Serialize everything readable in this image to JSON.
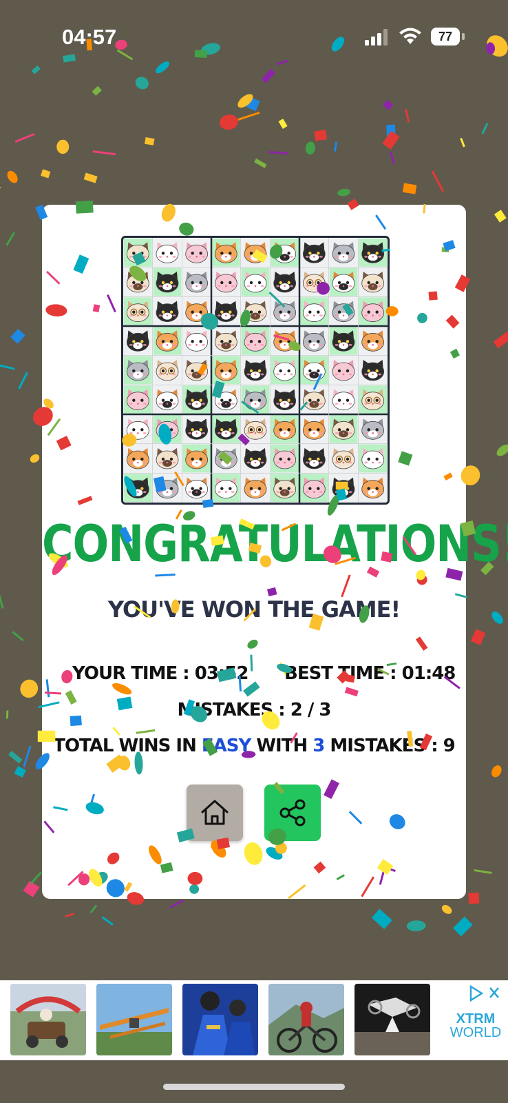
{
  "status_bar": {
    "time": "04:57",
    "battery": "77"
  },
  "board": {
    "size": 9,
    "cells": [
      [
        "siamese",
        "white",
        "pink",
        "orange",
        "orange",
        "calico",
        "black",
        "gray",
        "black"
      ],
      [
        "siamese",
        "black",
        "gray",
        "pink",
        "white",
        "black",
        "glasses",
        "calico",
        "siamese"
      ],
      [
        "glasses",
        "black",
        "orange",
        "black",
        "siamese",
        "gray",
        "white",
        "gray",
        "pink"
      ],
      [
        "black",
        "orange",
        "white",
        "siamese",
        "pink",
        "orange",
        "gray",
        "black",
        "orange"
      ],
      [
        "gray",
        "glasses",
        "siamese",
        "orange",
        "black",
        "white",
        "calico",
        "pink",
        "black"
      ],
      [
        "pink",
        "calico",
        "black",
        "calico",
        "gray",
        "black",
        "siamese",
        "white",
        "glasses"
      ],
      [
        "white",
        "pink",
        "black",
        "black",
        "glasses",
        "orange",
        "orange",
        "siamese",
        "gray"
      ],
      [
        "orange",
        "siamese",
        "orange",
        "gray",
        "black",
        "pink",
        "black",
        "glasses",
        "white"
      ],
      [
        "black",
        "gray",
        "calico",
        "white",
        "orange",
        "siamese",
        "pink",
        "black",
        "orange"
      ]
    ],
    "green_cells": [
      [
        0,
        0
      ],
      [
        0,
        3
      ],
      [
        0,
        5
      ],
      [
        1,
        1
      ],
      [
        1,
        7
      ],
      [
        2,
        0
      ],
      [
        2,
        6
      ],
      [
        2,
        8
      ],
      [
        3,
        1
      ],
      [
        3,
        4
      ],
      [
        3,
        7
      ],
      [
        4,
        3
      ],
      [
        4,
        5
      ],
      [
        4,
        6
      ],
      [
        5,
        0
      ],
      [
        5,
        2
      ],
      [
        5,
        4
      ],
      [
        5,
        8
      ],
      [
        6,
        1
      ],
      [
        6,
        3
      ],
      [
        6,
        7
      ],
      [
        7,
        2
      ],
      [
        7,
        5
      ],
      [
        7,
        8
      ],
      [
        8,
        0
      ],
      [
        8,
        3
      ],
      [
        8,
        6
      ],
      [
        0,
        8
      ],
      [
        1,
        4
      ],
      [
        4,
        0
      ],
      [
        6,
        5
      ],
      [
        8,
        5
      ]
    ]
  },
  "result": {
    "title": "CONGRATULATIONS!",
    "subtitle": "YOU'VE WON THE GAME!",
    "your_time": "YOUR TIME : 03:52",
    "best_time": "BEST TIME : 01:48",
    "mistakes": "MISTAKES : 2 / 3",
    "total_wins_prefix": "TOTAL WINS IN ",
    "total_wins_difficulty": "EASY",
    "total_wins_mid": " WITH ",
    "total_wins_mistakes": "3",
    "total_wins_suffix": " MISTAKES : 9"
  },
  "buttons": {
    "home_icon": "home-icon",
    "share_icon": "share-icon"
  },
  "ad": {
    "logo_top": "XTRM",
    "logo_bottom": "WORLD",
    "thumbs": [
      "race-cart",
      "biplane",
      "motocross-riders",
      "mountain-bike",
      "moto-jump"
    ]
  },
  "colors": {
    "background": "#5f5a4c",
    "title_green": "#16a34a",
    "share_green": "#22c55e",
    "home_gray": "#b3aca5",
    "highlight_blue": "#1d4ed8",
    "cell_green": "#b9f0c4"
  }
}
